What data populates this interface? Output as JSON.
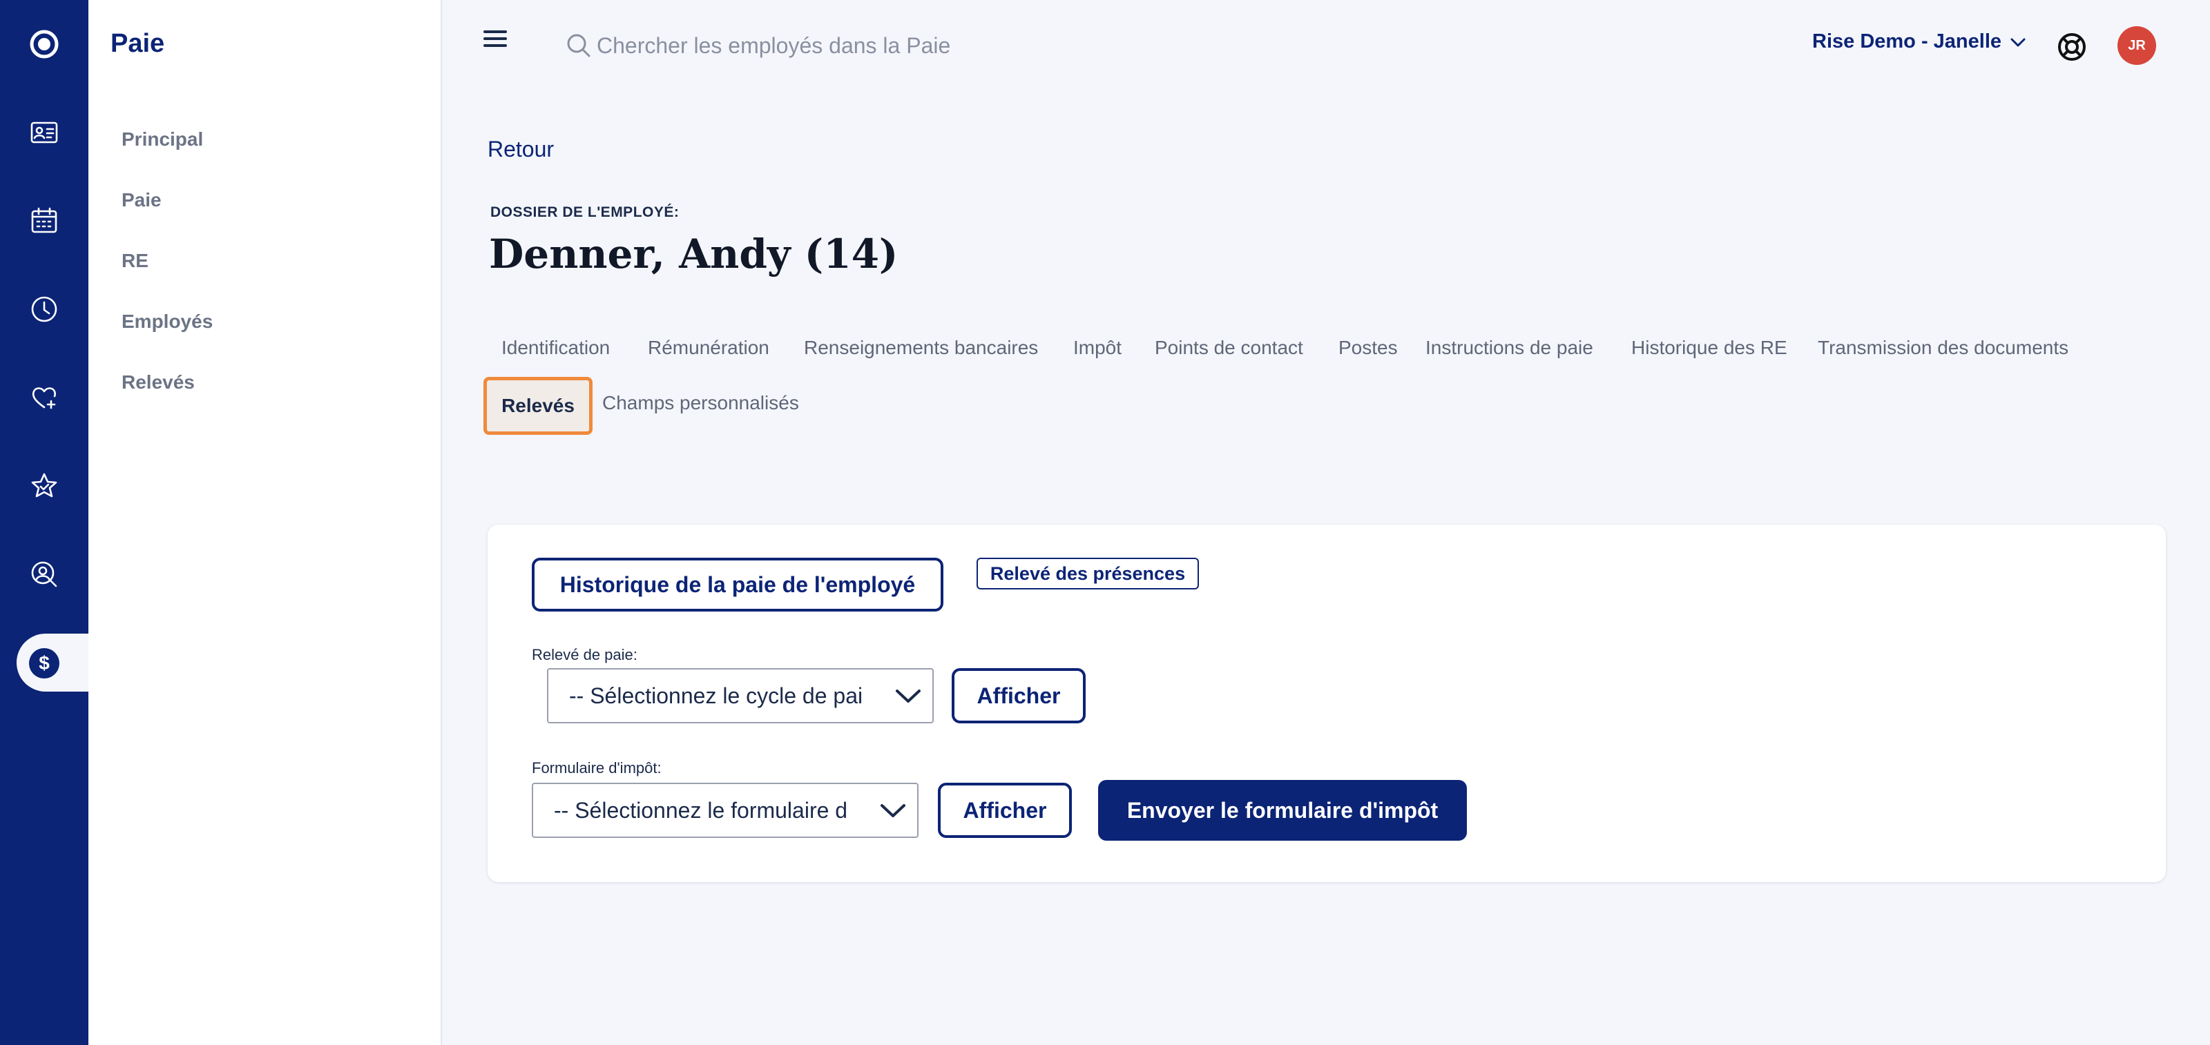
{
  "rail": {
    "icons": [
      "logo-icon",
      "id-card-icon",
      "calendar-icon",
      "clock-icon",
      "heart-plus-icon",
      "star-icon",
      "person-search-icon",
      "dollar-icon"
    ]
  },
  "sidebar": {
    "title": "Paie",
    "items": [
      {
        "label": "Principal"
      },
      {
        "label": "Paie"
      },
      {
        "label": "RE"
      },
      {
        "label": "Employés"
      },
      {
        "label": "Relevés"
      }
    ]
  },
  "header": {
    "search_placeholder": "Chercher les employés dans la Paie",
    "account_label": "Rise Demo - Janelle",
    "avatar_initials": "JR"
  },
  "main": {
    "back_label": "Retour",
    "eyebrow": "DOSSIER DE L'EMPLOYÉ:",
    "title": "Denner, Andy (14)",
    "tabs_row1": [
      {
        "label": "Identification"
      },
      {
        "label": "Rémunération"
      },
      {
        "label": "Renseignements bancaires"
      },
      {
        "label": "Impôt"
      },
      {
        "label": "Points de contact"
      },
      {
        "label": "Postes"
      },
      {
        "label": "Instructions de paie"
      },
      {
        "label": "Historique des RE"
      },
      {
        "label": "Transmission des documents"
      }
    ],
    "active_tab": "Relevés",
    "tabs_row2": [
      {
        "label": "Champs personnalisés"
      }
    ]
  },
  "card": {
    "history_button": "Historique de la paie de l'employé",
    "attendance_button": "Relevé des présences",
    "pay_stub_label": "Relevé de paie:",
    "pay_stub_select": "-- Sélectionnez le cycle de pai",
    "pay_stub_show": "Afficher",
    "tax_form_label": "Formulaire d'impôt:",
    "tax_form_select": "-- Sélectionnez le formulaire d",
    "tax_form_show": "Afficher",
    "send_tax_form": "Envoyer le formulaire d'impôt"
  },
  "colors": {
    "brand": "#0c2476",
    "accent_highlight": "#ef8a3c",
    "avatar": "#d7463a"
  }
}
